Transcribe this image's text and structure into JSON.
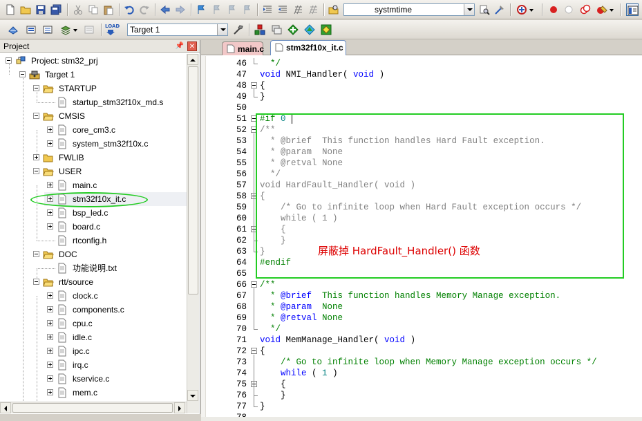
{
  "toolbar": {
    "find_combo_value": "systmtime",
    "target_combo_value": "Target 1",
    "load_label": "LOAD",
    "icons": [
      "new-file",
      "open-folder",
      "save",
      "save-all",
      "cut",
      "copy",
      "paste",
      "undo",
      "redo",
      "nav-back",
      "nav-forward",
      "bookmark",
      "bookmark-prev",
      "bookmark-next",
      "bookmark-clear",
      "indent",
      "unindent",
      "comment",
      "uncomment",
      "find-in-files",
      "find",
      "incremental-find",
      "debug-start",
      "breakpoint-insert",
      "breakpoint-enable",
      "breakpoint-disable",
      "breakpoint-kill",
      "window-config",
      "translate",
      "build",
      "rebuild",
      "batch-build",
      "stop-build",
      "download",
      "target-options",
      "manage-components",
      "select-packs",
      "pack-installer",
      "run-time-env"
    ]
  },
  "project": {
    "title": "Project",
    "root_label": "Project: stm32_prj",
    "target_label": "Target 1",
    "items": [
      {
        "label": "STARTUP",
        "type": "folder",
        "level": 2,
        "expanded": true
      },
      {
        "label": "startup_stm32f10x_md.s",
        "type": "file",
        "level": 3,
        "expander": false
      },
      {
        "label": "CMSIS",
        "type": "folder",
        "level": 2,
        "expanded": true
      },
      {
        "label": "core_cm3.c",
        "type": "file",
        "level": 3,
        "expander": true
      },
      {
        "label": "system_stm32f10x.c",
        "type": "file",
        "level": 3,
        "expander": true
      },
      {
        "label": "FWLIB",
        "type": "folder",
        "level": 2,
        "expanded": false
      },
      {
        "label": "USER",
        "type": "folder",
        "level": 2,
        "expanded": true
      },
      {
        "label": "main.c",
        "type": "file",
        "level": 3,
        "expander": true
      },
      {
        "label": "stm32f10x_it.c",
        "type": "file",
        "level": 3,
        "expander": true,
        "selected": true
      },
      {
        "label": "bsp_led.c",
        "type": "file",
        "level": 3,
        "expander": true
      },
      {
        "label": "board.c",
        "type": "file",
        "level": 3,
        "expander": true
      },
      {
        "label": "rtconfig.h",
        "type": "file",
        "level": 3,
        "expander": false
      },
      {
        "label": "DOC",
        "type": "folder",
        "level": 2,
        "expanded": true
      },
      {
        "label": "功能说明.txt",
        "type": "file",
        "level": 3,
        "expander": false
      },
      {
        "label": "rtt/source",
        "type": "folder",
        "level": 2,
        "expanded": true
      },
      {
        "label": "clock.c",
        "type": "file",
        "level": 3,
        "expander": true
      },
      {
        "label": "components.c",
        "type": "file",
        "level": 3,
        "expander": true
      },
      {
        "label": "cpu.c",
        "type": "file",
        "level": 3,
        "expander": true
      },
      {
        "label": "idle.c",
        "type": "file",
        "level": 3,
        "expander": true
      },
      {
        "label": "ipc.c",
        "type": "file",
        "level": 3,
        "expander": true
      },
      {
        "label": "irq.c",
        "type": "file",
        "level": 3,
        "expander": true
      },
      {
        "label": "kservice.c",
        "type": "file",
        "level": 3,
        "expander": true
      },
      {
        "label": "mem.c",
        "type": "file",
        "level": 3,
        "expander": true
      }
    ]
  },
  "editor": {
    "tabs": [
      {
        "label": "main.c",
        "active": false
      },
      {
        "label": "stm32f10x_it.c",
        "active": true
      }
    ],
    "lines": [
      {
        "n": "46",
        "segs": [
          [
            "  */",
            "cm"
          ]
        ]
      },
      {
        "n": "47",
        "segs": [
          [
            "void",
            "kw"
          ],
          [
            " NMI_Handler( ",
            "black"
          ],
          [
            "void",
            "kw"
          ],
          [
            " )",
            "black"
          ]
        ]
      },
      {
        "n": "48",
        "fold": true,
        "segs": [
          [
            "{",
            "black"
          ]
        ]
      },
      {
        "n": "49",
        "segs": [
          [
            "}",
            "black"
          ]
        ]
      },
      {
        "n": "50",
        "segs": []
      },
      {
        "n": "51",
        "fold": true,
        "segs": [
          [
            "#if ",
            "pp"
          ],
          [
            "0",
            "num"
          ]
        ]
      },
      {
        "n": "52",
        "fold": true,
        "segs": [
          [
            "/**",
            "tag"
          ]
        ]
      },
      {
        "n": "53",
        "segs": [
          [
            "  * ",
            "tag"
          ],
          [
            "@brief  This function handles Hard Fault exception.",
            "tag"
          ]
        ]
      },
      {
        "n": "54",
        "segs": [
          [
            "  * ",
            "tag"
          ],
          [
            "@param  None",
            "tag"
          ]
        ]
      },
      {
        "n": "55",
        "segs": [
          [
            "  * ",
            "tag"
          ],
          [
            "@retval None",
            "tag"
          ]
        ]
      },
      {
        "n": "56",
        "segs": [
          [
            "  */",
            "tag"
          ]
        ]
      },
      {
        "n": "57",
        "segs": [
          [
            "void HardFault_Handler( void )",
            "tag"
          ]
        ]
      },
      {
        "n": "58",
        "fold": true,
        "segs": [
          [
            "{",
            "tag"
          ]
        ]
      },
      {
        "n": "59",
        "segs": [
          [
            "    /* Go to infinite loop when Hard Fault exception occurs */",
            "tag"
          ]
        ]
      },
      {
        "n": "60",
        "segs": [
          [
            "    while ( 1 )",
            "tag"
          ]
        ]
      },
      {
        "n": "61",
        "fold": true,
        "segs": [
          [
            "    {",
            "tag"
          ]
        ]
      },
      {
        "n": "62",
        "segs": [
          [
            "    }",
            "tag"
          ]
        ]
      },
      {
        "n": "63",
        "segs": [
          [
            "}",
            "tag"
          ]
        ]
      },
      {
        "n": "64",
        "segs": [
          [
            "#endif",
            "pp"
          ]
        ]
      },
      {
        "n": "65",
        "segs": []
      },
      {
        "n": "66",
        "fold": true,
        "segs": [
          [
            "/**",
            "cm"
          ]
        ]
      },
      {
        "n": "67",
        "segs": [
          [
            "  * ",
            "cm"
          ],
          [
            "@brief",
            "kw"
          ],
          [
            "  This function handles Memory Manage exception.",
            "cm"
          ]
        ]
      },
      {
        "n": "68",
        "segs": [
          [
            "  * ",
            "cm"
          ],
          [
            "@param",
            "kw"
          ],
          [
            "  None",
            "cm"
          ]
        ]
      },
      {
        "n": "69",
        "segs": [
          [
            "  * ",
            "cm"
          ],
          [
            "@retval",
            "kw"
          ],
          [
            " None",
            "cm"
          ]
        ]
      },
      {
        "n": "70",
        "segs": [
          [
            "  */",
            "cm"
          ]
        ]
      },
      {
        "n": "71",
        "segs": [
          [
            "void",
            "kw"
          ],
          [
            " MemManage_Handler( ",
            "black"
          ],
          [
            "void",
            "kw"
          ],
          [
            " )",
            "black"
          ]
        ]
      },
      {
        "n": "72",
        "fold": true,
        "segs": [
          [
            "{",
            "black"
          ]
        ]
      },
      {
        "n": "73",
        "segs": [
          [
            "    ",
            "black"
          ],
          [
            "/* Go to infinite loop when Memory Manage exception occurs */",
            "cm"
          ]
        ]
      },
      {
        "n": "74",
        "segs": [
          [
            "    ",
            "black"
          ],
          [
            "while",
            "kw"
          ],
          [
            " ( ",
            "black"
          ],
          [
            "1",
            "num"
          ],
          [
            " )",
            "black"
          ]
        ]
      },
      {
        "n": "75",
        "fold": true,
        "segs": [
          [
            "    {",
            "black"
          ]
        ]
      },
      {
        "n": "76",
        "segs": [
          [
            "    }",
            "black"
          ]
        ]
      },
      {
        "n": "77",
        "segs": [
          [
            "}",
            "black"
          ]
        ]
      },
      {
        "n": "78",
        "segs": []
      }
    ],
    "annotation": "屏蔽掉 HardFault_Handler() 函数"
  },
  "colors": {
    "highlight_green": "#22cc22",
    "annotation_red": "#dd0000",
    "keyword_blue": "#0000ff",
    "comment_green": "#008000",
    "inactive_gray": "#808080"
  }
}
